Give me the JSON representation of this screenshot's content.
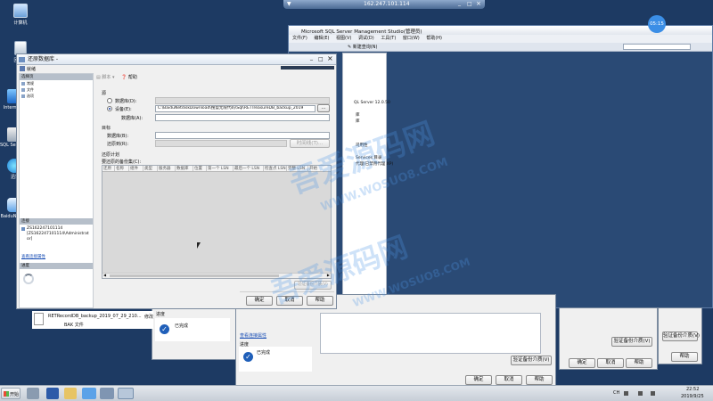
{
  "remote_bar": {
    "host": "162.247.101.114"
  },
  "desktop": {
    "icons": [
      {
        "label": "计算机"
      },
      {
        "label": "回收站"
      },
      {
        "label": "Intern 服务"
      },
      {
        "label": "SQL Se 2014 M"
      },
      {
        "label": "迅雷"
      },
      {
        "label": "BaiduN - 快捷"
      }
    ]
  },
  "ssms": {
    "title": "Microsoft SQL Server Management Studio(管理员)",
    "menu": [
      "文件(F)",
      "编辑(E)",
      "视图(V)",
      "调试(D)",
      "工具(T)",
      "窗口(W)",
      "帮助(H)"
    ],
    "new_query_label": "新建查询(N)",
    "explorer_lines": [
      "QL Server 12.0.50",
      "库",
      "库",
      "司用性",
      "Services 目录",
      "代理(已禁用代理 XP)"
    ],
    "time_badge": "05:15"
  },
  "restore_dialog": {
    "title": "还原数据库 -",
    "status": "就绪",
    "left_header_pages": "选择页",
    "pages": [
      "常规",
      "文件",
      "选项"
    ],
    "connection_header": "连接",
    "connection_server": "ZS162247101114",
    "connection_user": "[ZS162247101114\\Administrat or]",
    "view_connection_props": "查看连接属性",
    "progress_header": "进度",
    "toolbar_script": "脚本",
    "toolbar_help": "帮助",
    "source_header": "源",
    "option_database": "数据库(D):",
    "option_device": "设备(E):",
    "device_path": "C:\\BaiduNetdiskDownload\\搜盟无限代码\\Sql\\RETTreasureDB_backup_2019",
    "db_label": "数据库(A):",
    "dest_header": "目标",
    "dest_db_label": "数据库(B):",
    "restore_to_label": "还原到(R):",
    "timeline_button": "时间线(T)...",
    "plan_header": "还原计划",
    "backup_sets_label": "要还原的备份集(C):",
    "columns": [
      "还原",
      "名称",
      "组件",
      "类型",
      "服务器",
      "数据库",
      "位置",
      "第一个 LSN",
      "最后一个 LSN",
      "检查点 LSN",
      "完整 LSN",
      "开始"
    ],
    "verify_button": "验证备份介质(V)",
    "ok": "确定",
    "cancel": "取消",
    "help": "帮助"
  },
  "bg_dialog_1": {
    "progress_header": "进度",
    "status": "已完成",
    "ok": "确定",
    "cancel": "取消",
    "help": "帮助"
  },
  "bg_dialog_2": {
    "view_connection_props": "查看连接属性",
    "progress_header": "进度",
    "status": "已完成",
    "verify_button": "验证备份介质(V)",
    "ok": "确定",
    "cancel": "取消",
    "help": "帮助"
  },
  "bg_dialog_3": {
    "verify_button": "验证备份介质(V)",
    "ok": "确定",
    "cancel": "取消",
    "help": "帮助"
  },
  "bg_dialog_4": {
    "verify_button": "验证备份介质(V)",
    "help": "帮助"
  },
  "file_item": {
    "name": "RETRecordDB_backup_2019_07_29_210...",
    "type": "BAK 文件",
    "suffix": "修改"
  },
  "taskbar": {
    "start_label": "开始",
    "tray_lang": "CH",
    "time": "22:52",
    "date": "2019/9/25"
  },
  "watermark": {
    "brand": "吾爱源码网",
    "url": "WWW.WOSUO8.COM"
  }
}
